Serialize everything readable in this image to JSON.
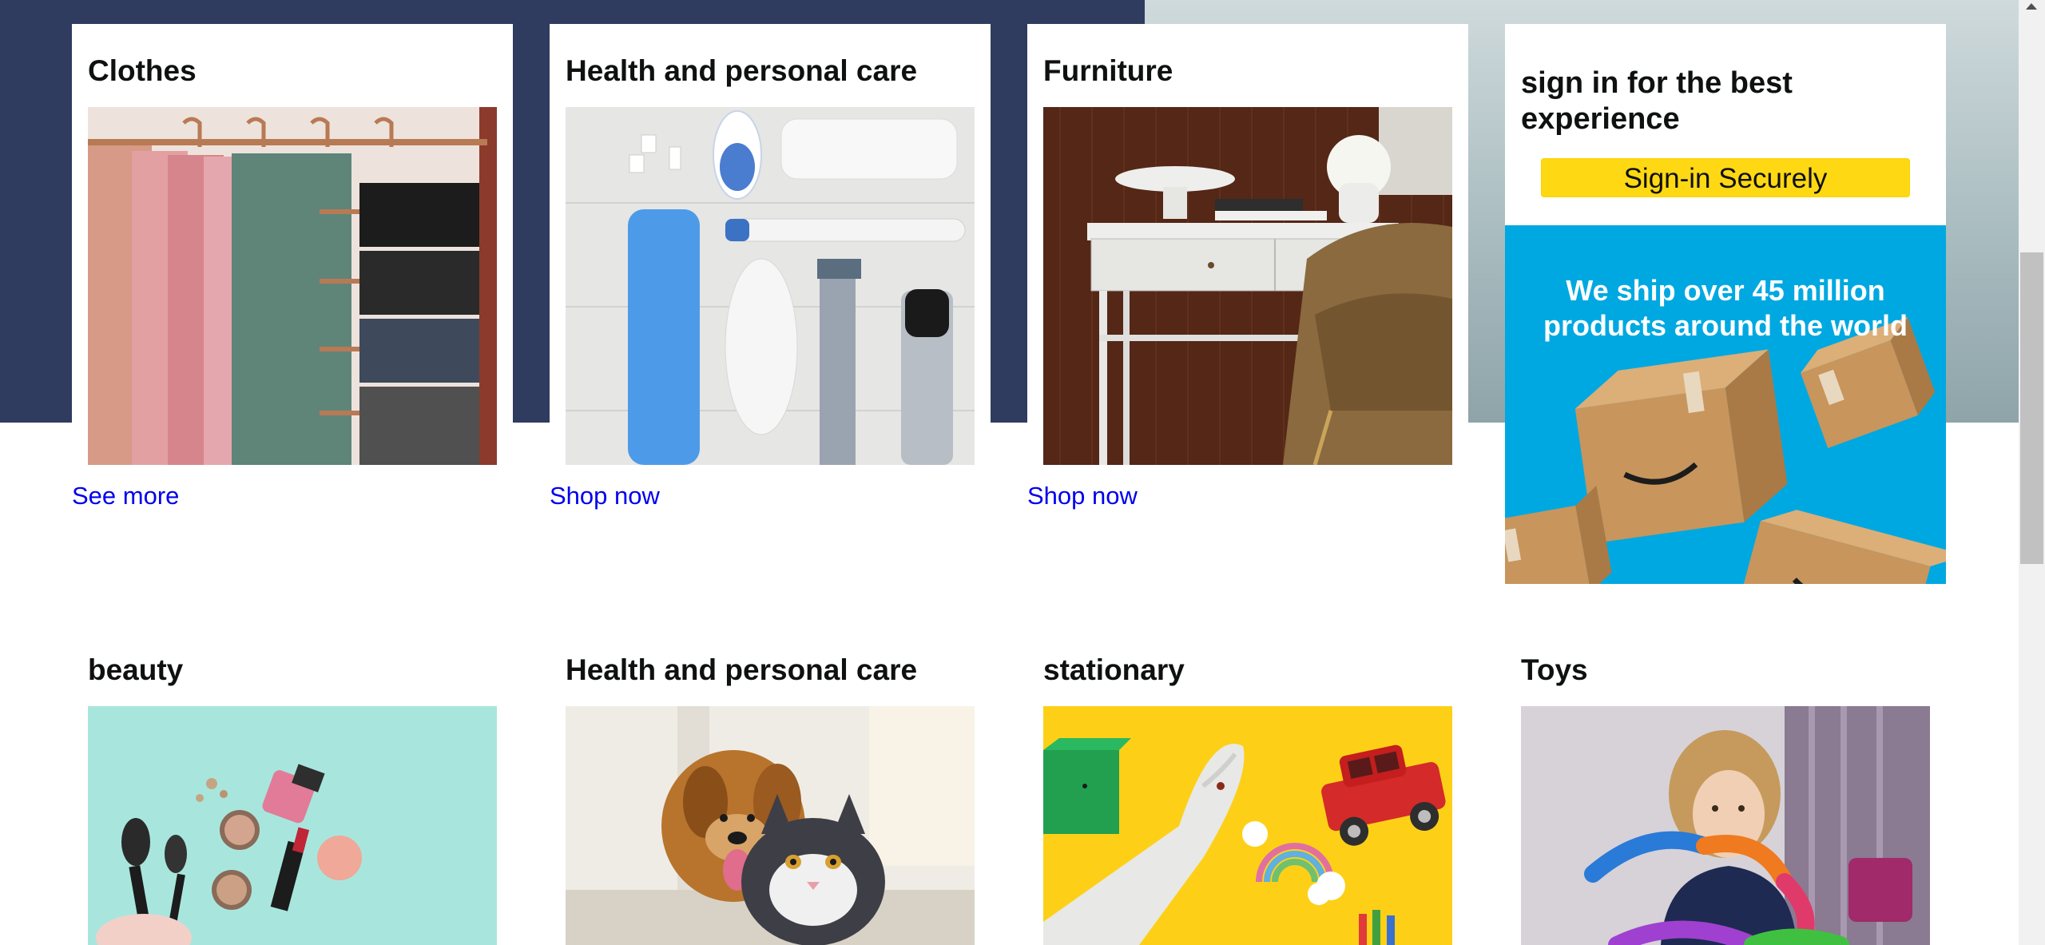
{
  "row1": [
    {
      "title": "Clothes",
      "link": "See more"
    },
    {
      "title": "Health and personal care",
      "link": "Shop now"
    },
    {
      "title": "Furniture",
      "link": "Shop now"
    }
  ],
  "signin": {
    "title": "sign in for the best experience",
    "button": "Sign-in Securely",
    "banner_text": "We ship over 45 million products around the world"
  },
  "row2": [
    {
      "title": "beauty"
    },
    {
      "title": "Health and personal care"
    },
    {
      "title": "stationary"
    },
    {
      "title": "Toys"
    }
  ],
  "colors": {
    "hero_navy": "#2f3c60",
    "signin_button": "#ffd814",
    "banner_blue": "#00a8e1",
    "link": "#0000ee"
  }
}
